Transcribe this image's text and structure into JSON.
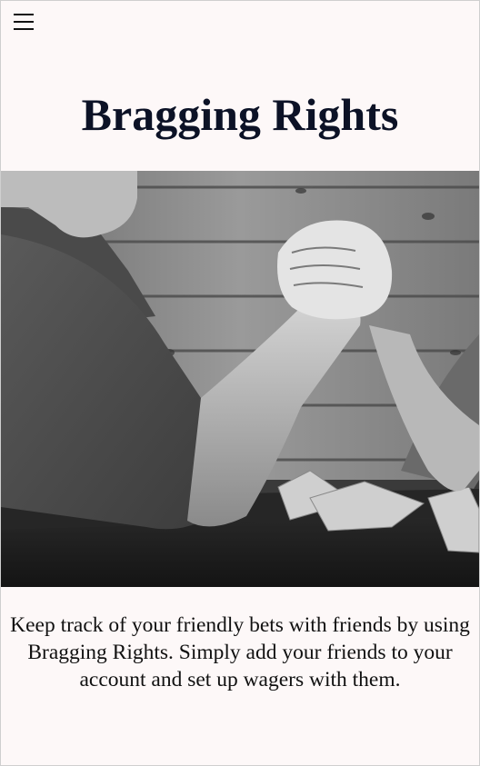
{
  "header": {
    "menu_icon": "hamburger-menu-icon",
    "title": "Bragging Rights"
  },
  "hero": {
    "image_subject": "arm-wrestling-photo"
  },
  "intro": {
    "text": "Keep track of your friendly bets with friends by using Bragging Rights. Simply add your friends to your account and set up wagers with them."
  },
  "colors": {
    "background": "#fdf8f8",
    "title": "#0c1226",
    "text": "#111111"
  }
}
